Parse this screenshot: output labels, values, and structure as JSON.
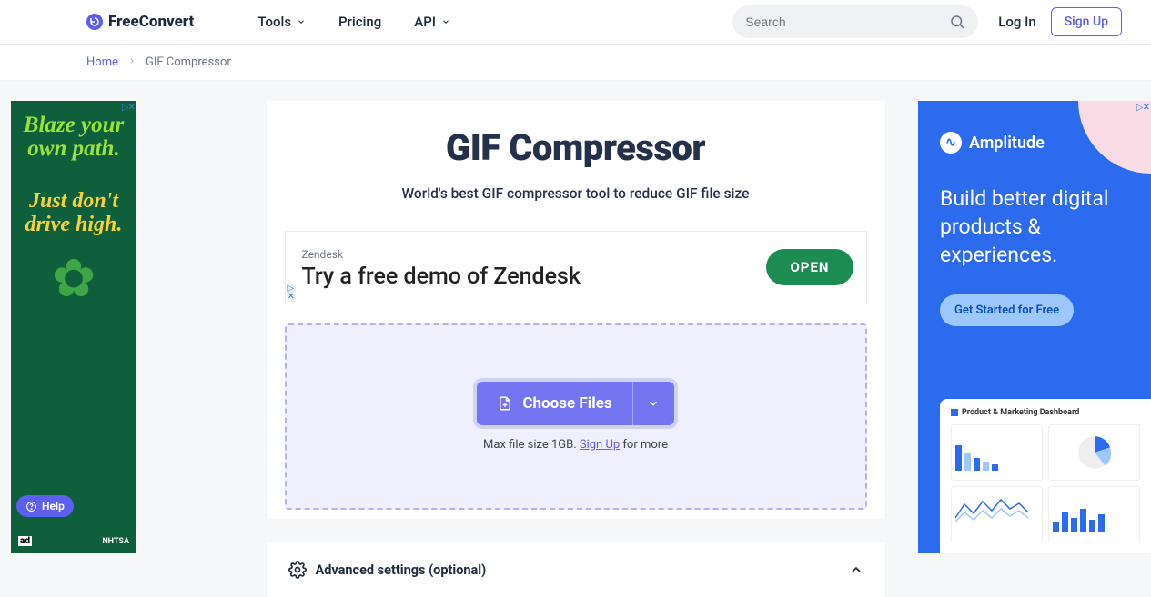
{
  "header": {
    "brand_prefix": "Free",
    "brand_suffix": "Convert",
    "nav": {
      "tools": "Tools",
      "pricing": "Pricing",
      "api": "API"
    },
    "search_placeholder": "Search",
    "login": "Log In",
    "signup": "Sign Up"
  },
  "breadcrumbs": {
    "home": "Home",
    "current": "GIF Compressor"
  },
  "main": {
    "title": "GIF Compressor",
    "subtitle": "World's best GIF compressor tool to reduce GIF file size",
    "choose_label": "Choose Files",
    "caption_prefix": "Max file size 1GB. ",
    "caption_link": "Sign Up",
    "caption_suffix": " for more",
    "advanced_label": "Advanced settings (optional)"
  },
  "inline_ad": {
    "sponsor": "Zendesk",
    "headline": "Try a free demo of Zendesk",
    "cta": "OPEN"
  },
  "left_ad": {
    "line1": "Blaze your own path.",
    "line2": "Just don't drive high.",
    "badge": "ad",
    "org": "NHTSA"
  },
  "right_ad": {
    "brand": "Amplitude",
    "headline": "Build better digital products & experiences.",
    "cta": "Get Started for Free",
    "dash_title": "Product & Marketing Dashboard"
  },
  "help": "Help"
}
